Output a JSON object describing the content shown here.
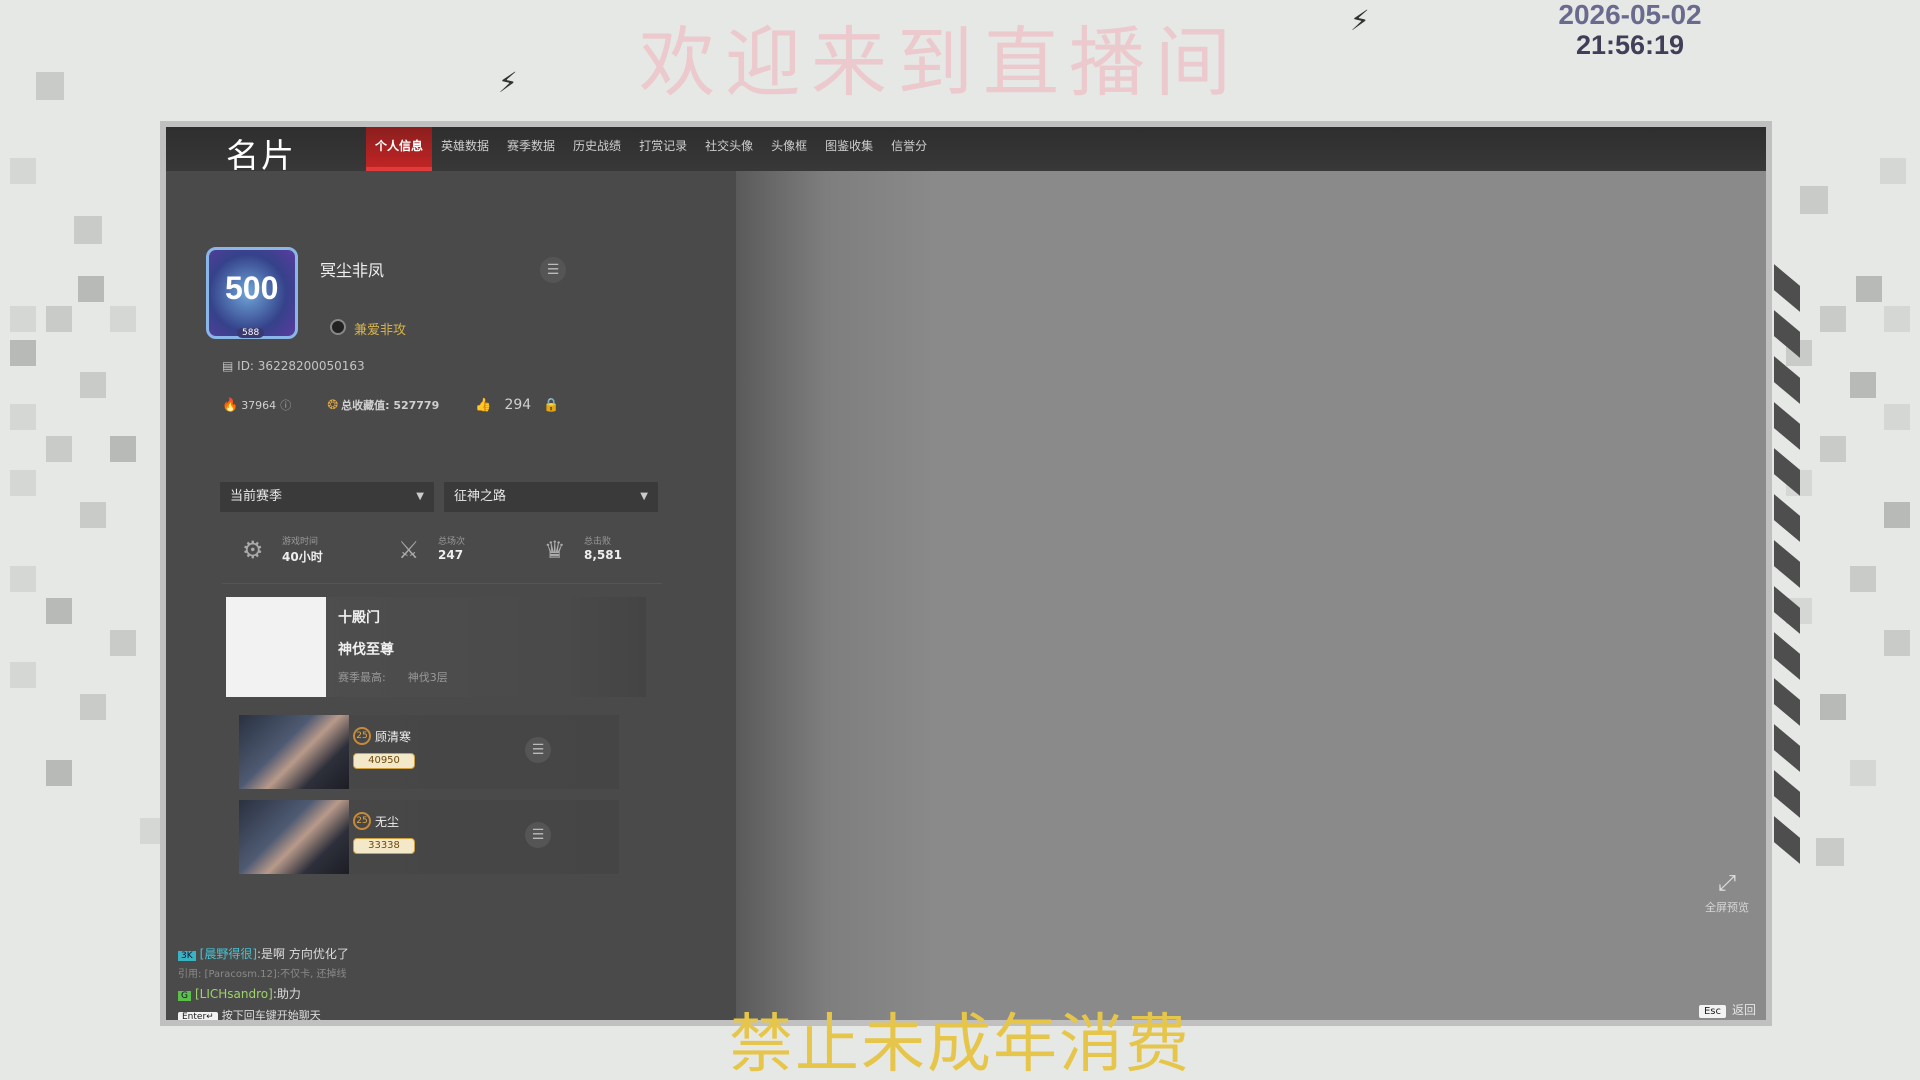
{
  "overlay": {
    "welcome_text": "欢迎来到直播间",
    "date": "2026-05-02",
    "time": "21:56:19",
    "minor_warning": "禁止未成年消费",
    "colors": {
      "welcome": "#ecc9cc",
      "warning": "#e6c64a",
      "date": "#6a6a8e"
    }
  },
  "window": {
    "title": "名片",
    "tabs": [
      "个人信息",
      "英雄数据",
      "赛季数据",
      "历史战绩",
      "打赏记录",
      "社交头像",
      "头像框",
      "图鉴收集",
      "信誉分"
    ],
    "active_tab": "个人信息",
    "accent_color": "#c02424"
  },
  "profile": {
    "avatar_number": "500",
    "avatar_level": "588",
    "username": "冥尘非凤",
    "guild": "兼爱非攻",
    "id_text": "ID: 36228200050163",
    "heat": "37964",
    "collection_value": "总收藏值: 527779",
    "likes": "294",
    "menu_icon": "list-icon"
  },
  "filters": {
    "season": "当前赛季",
    "mode": "征神之路"
  },
  "season_stats": [
    {
      "label": "游戏时间",
      "value": "40小时",
      "icon": "clock-icon"
    },
    {
      "label": "总场次",
      "value": "247",
      "icon": "crossed-swords-icon"
    },
    {
      "label": "总击败",
      "value": "8,581",
      "icon": "trophy-icon"
    }
  ],
  "rank": {
    "name": "十殿门",
    "tier": "神伐至尊",
    "best_label": "赛季最高:",
    "best_value": "神伐3层"
  },
  "heroes": [
    {
      "name": "顾清寒",
      "score": "40950",
      "badge": "25"
    },
    {
      "name": "无尘",
      "score": "33338",
      "badge": "25"
    }
  ],
  "chat": {
    "line1_tag": "3K",
    "line1_nick": "[晨野得很]",
    "line1_text": ":是啊 方向优化了",
    "quote": "引用: [Paracosm.12]:不仅卡, 还掉线",
    "line2_tag": "G",
    "line2_nick": "[LICHsandro]",
    "line2_text": ":助力",
    "enter_key": "Enter↵",
    "enter_hint": "按下回车键开始聊天"
  },
  "controls": {
    "fullscreen_label": "全屏预览",
    "esc_key": "Esc",
    "back_label": "返回"
  }
}
